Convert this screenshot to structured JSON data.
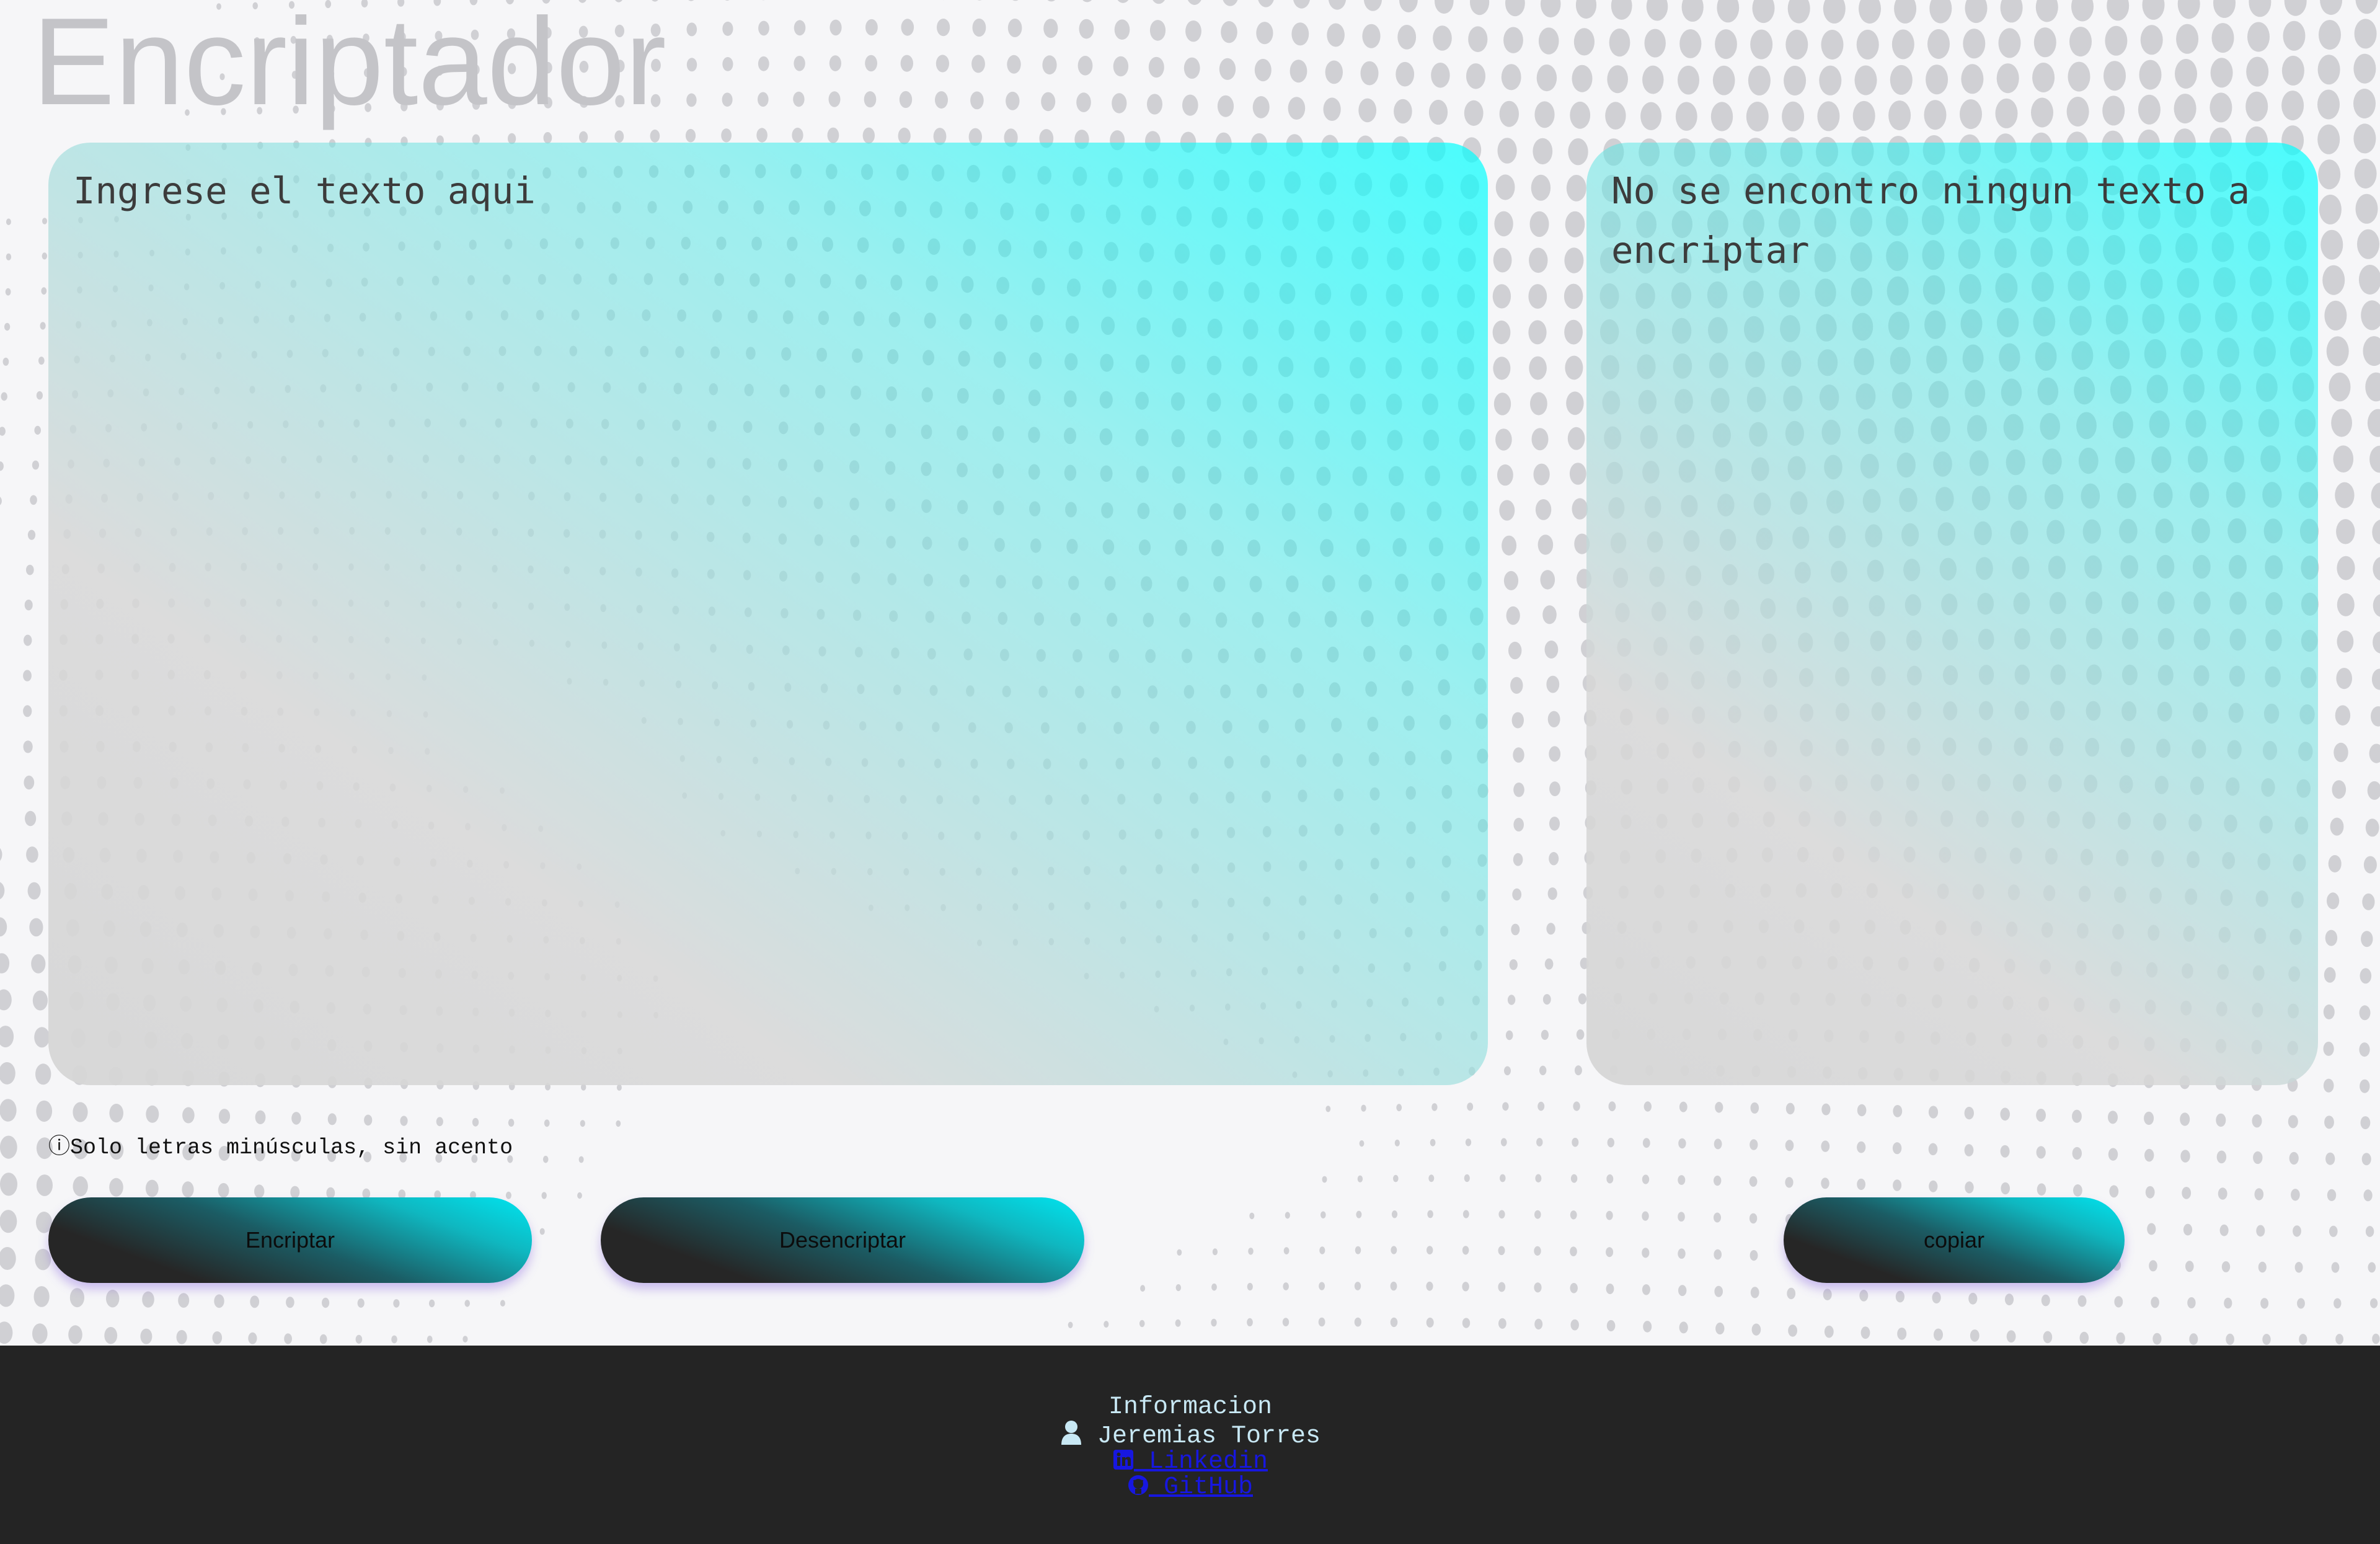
{
  "header": {
    "title": "Encriptador"
  },
  "input": {
    "placeholder": "Ingrese el texto aqui",
    "value": ""
  },
  "output": {
    "message": "No se encontro ningun texto a encriptar"
  },
  "hint": {
    "icon": "info-icon",
    "text": "ⓘSolo letras minúsculas, sin acento"
  },
  "buttons": {
    "encrypt_label": "Encriptar",
    "decrypt_label": "Desencriptar",
    "copy_label": "copiar"
  },
  "footer": {
    "heading": "Informacion",
    "author": "Jeremias Torres",
    "author_icon": "user-icon",
    "links": [
      {
        "label": " Linkedin",
        "icon": "linkedin-icon"
      },
      {
        "label": " GitHub",
        "icon": "github-icon"
      }
    ]
  },
  "colors": {
    "accent": "#00ffff",
    "button_dark": "#262626",
    "footer_bg": "#242424",
    "title": "#c4c4c8",
    "link": "#1717e0",
    "footer_text": "#c8e8f4"
  }
}
